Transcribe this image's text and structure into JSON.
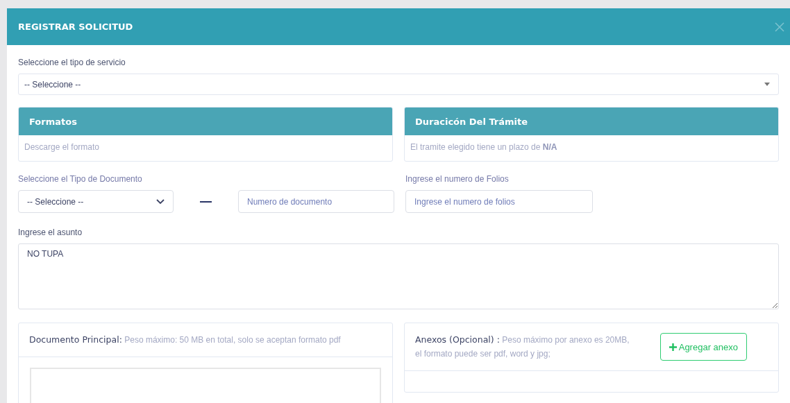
{
  "modal": {
    "title": "REGISTRAR SOLICITUD"
  },
  "service": {
    "label": "Seleccione el tipo de servicio",
    "value": "-- Seleccione --"
  },
  "cards": [
    {
      "title": "Formatos",
      "body": "Descarge el formato"
    },
    {
      "title": "Duracicón Del Trámite",
      "body": "El tramite elegido tiene un plazo de **N/A**"
    }
  ],
  "document_type": {
    "label": "Seleccione el Tipo de Documento",
    "value": "-- Seleccione --"
  },
  "document_number": {
    "placeholder": "Numero de documento"
  },
  "folios": {
    "label": "Ingrese el numero de Folios",
    "placeholder": "Ingrese el numero de folios"
  },
  "subject": {
    "label": "Ingrese el asunto",
    "value": "NO TUPA"
  },
  "main_document": {
    "title": "Documento Principal:",
    "note": "Peso máximo: 50 MB en total, solo se aceptan formato pdf"
  },
  "annexes": {
    "title": "Anexos (Opcional) :",
    "note": "Peso máximo por anexo es 20MB, el formato puede ser pdf, word y jpg;",
    "button": "Agregar anexo"
  }
}
